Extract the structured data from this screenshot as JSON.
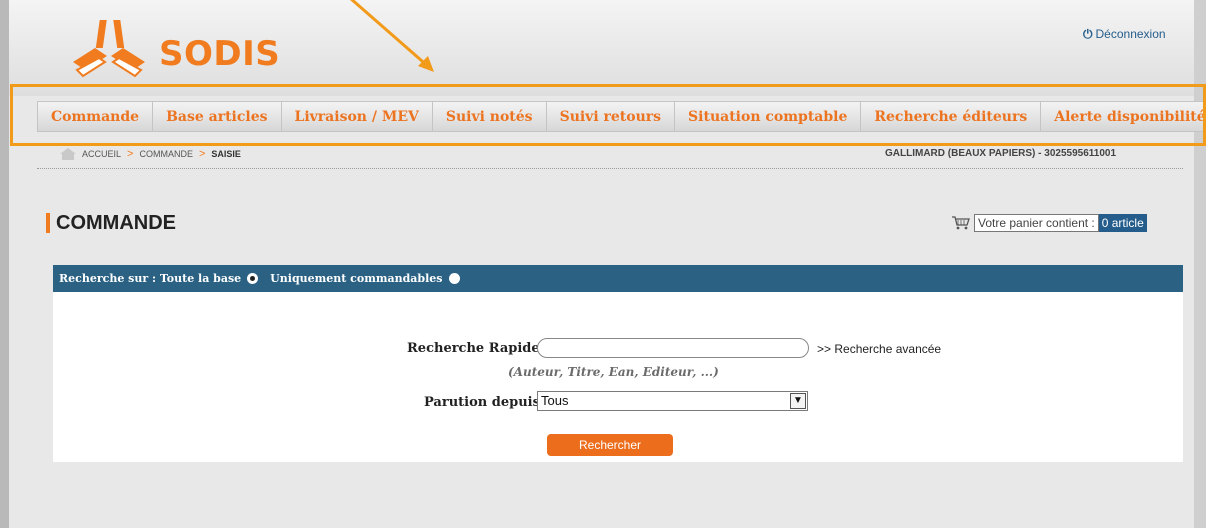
{
  "header": {
    "brand": "SODIS",
    "logout_label": "Déconnexion"
  },
  "menu": [
    {
      "label": "Commande"
    },
    {
      "label": "Base articles"
    },
    {
      "label": "Livraison / MEV"
    },
    {
      "label": "Suivi notés"
    },
    {
      "label": "Suivi retours"
    },
    {
      "label": "Situation comptable"
    },
    {
      "label": "Recherche éditeurs"
    },
    {
      "label": "Alerte disponibilité"
    }
  ],
  "breadcrumb": {
    "items": [
      "ACCUEIL",
      "COMMANDE",
      "SAISIE"
    ],
    "separator": ">"
  },
  "client_info": "GALLIMARD (BEAUX PAPIERS) - 3025595611001",
  "page": {
    "title": "COMMANDE"
  },
  "cart": {
    "label": "Votre panier contient :",
    "count": "0 article"
  },
  "search_scope": {
    "prefix": "Recherche sur : Toute la base",
    "option2": "Uniquement commandables",
    "selected": "Toute la base"
  },
  "search_form": {
    "quick_label": "Recherche Rapide",
    "quick_value": "",
    "advanced_link": ">> Recherche avancée",
    "hint": "(Auteur, Titre, Ean, Editeur, ...)",
    "parution_label": "Parution depuis",
    "parution_value": "Tous",
    "submit_label": "Rechercher"
  },
  "colors": {
    "accent": "#f07c1f",
    "bar": "#2b6284",
    "highlight": "#f29a1a"
  }
}
